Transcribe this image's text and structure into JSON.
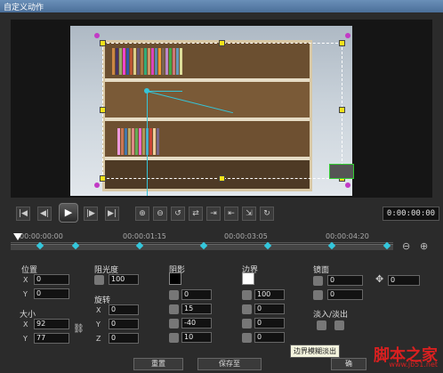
{
  "window": {
    "title": "自定义动作"
  },
  "playback": {
    "timecode": "0:00:00:00"
  },
  "timeline": {
    "labels": [
      "00:00:00:00",
      "00:00:01:15",
      "00:00:03:05",
      "00:00:04:20"
    ]
  },
  "properties": {
    "position": {
      "label": "位置",
      "x": "0",
      "y": "0"
    },
    "size": {
      "label": "大小",
      "x": "92",
      "y": "77"
    },
    "opacity": {
      "label": "阻光度",
      "value": "100"
    },
    "rotation": {
      "label": "旋转",
      "x": "0",
      "y": "0",
      "z": "0"
    },
    "shadow": {
      "label": "阴影",
      "v1": "0",
      "v2": "15",
      "v3": "-40",
      "v4": "10"
    },
    "border": {
      "label": "边界",
      "v1": "100",
      "v2": "0",
      "v3": "0",
      "v4": "0",
      "v5": "0"
    },
    "mirror": {
      "label": "镜面",
      "v1": "0",
      "v2": "0",
      "v3": "0"
    },
    "fade": {
      "label": "淡入/淡出"
    }
  },
  "tooltip": {
    "text": "边界模糊淡出"
  },
  "footer": {
    "reset": "重置",
    "save_as": "保存至",
    "ok": "确"
  },
  "watermark": {
    "main": "脚本之家",
    "url": "www.jb51.net"
  },
  "colors": {
    "selection_handle": "#f4e21a",
    "corner_handle": "#c23ac6",
    "guide": "#36c4d8",
    "keyframe": "#34c7dc"
  }
}
